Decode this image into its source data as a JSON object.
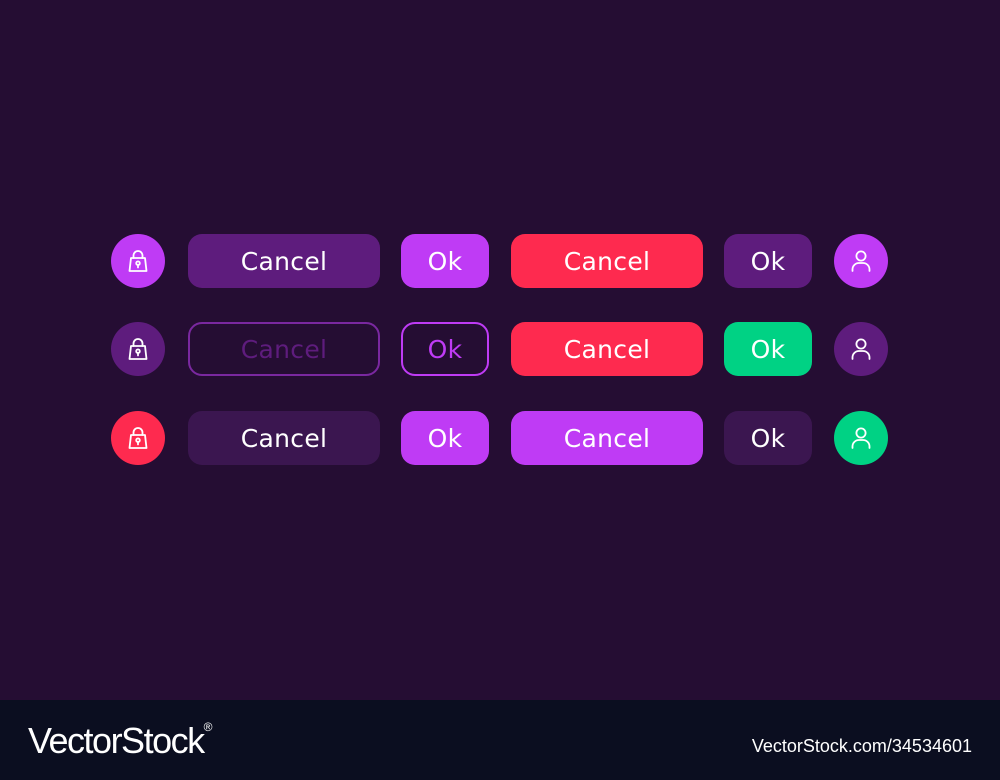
{
  "colors": {
    "background": "#250d33",
    "purple": "#bf3bf5",
    "purple_dark": "#5e1c7d",
    "purple_deep": "#3b1650",
    "red": "#fe2a4f",
    "green": "#00d284",
    "outline": "#7a28a0",
    "footer_bg": "#0b0e20"
  },
  "icons": {
    "lock": "lock-icon",
    "user": "user-icon"
  },
  "rows": [
    {
      "lock": {
        "bg": "#bf3bf5",
        "stroke": "#ffffff"
      },
      "cancel_a": {
        "label": "Cancel",
        "bg": "#5e1c7d",
        "text": "#ffffff",
        "border": "transparent"
      },
      "ok_a": {
        "label": "Ok",
        "bg": "#bf3bf5",
        "text": "#ffffff",
        "border": "transparent"
      },
      "cancel_b": {
        "label": "Cancel",
        "bg": "#fe2a4f",
        "text": "#ffffff",
        "border": "transparent"
      },
      "ok_b": {
        "label": "Ok",
        "bg": "#5e1c7d",
        "text": "#ffffff",
        "border": "transparent"
      },
      "user": {
        "bg": "#bf3bf5",
        "stroke": "#ffffff"
      }
    },
    {
      "lock": {
        "bg": "#5e1c7d",
        "stroke": "#ffffff"
      },
      "cancel_a": {
        "label": "Cancel",
        "bg": "transparent",
        "text": "#5e1c7d",
        "border": "#7a28a0"
      },
      "ok_a": {
        "label": "Ok",
        "bg": "transparent",
        "text": "#bf3bf5",
        "border": "#bf3bf5"
      },
      "cancel_b": {
        "label": "Cancel",
        "bg": "#fe2a4f",
        "text": "#ffffff",
        "border": "transparent"
      },
      "ok_b": {
        "label": "Ok",
        "bg": "#00d284",
        "text": "#ffffff",
        "border": "transparent"
      },
      "user": {
        "bg": "#5e1c7d",
        "stroke": "#ffffff"
      }
    },
    {
      "lock": {
        "bg": "#fe2a4f",
        "stroke": "#ffffff"
      },
      "cancel_a": {
        "label": "Cancel",
        "bg": "#3b1650",
        "text": "#ffffff",
        "border": "transparent"
      },
      "ok_a": {
        "label": "Ok",
        "bg": "#bf3bf5",
        "text": "#ffffff",
        "border": "transparent"
      },
      "cancel_b": {
        "label": "Cancel",
        "bg": "#bf3bf5",
        "text": "#ffffff",
        "border": "transparent"
      },
      "ok_b": {
        "label": "Ok",
        "bg": "#3b1650",
        "text": "#ffffff",
        "border": "transparent"
      },
      "user": {
        "bg": "#00d284",
        "stroke": "#ffffff"
      }
    }
  ],
  "footer": {
    "brand": "VectorStock",
    "brand_mark": "®",
    "stock_id": "VectorStock.com/34534601"
  }
}
